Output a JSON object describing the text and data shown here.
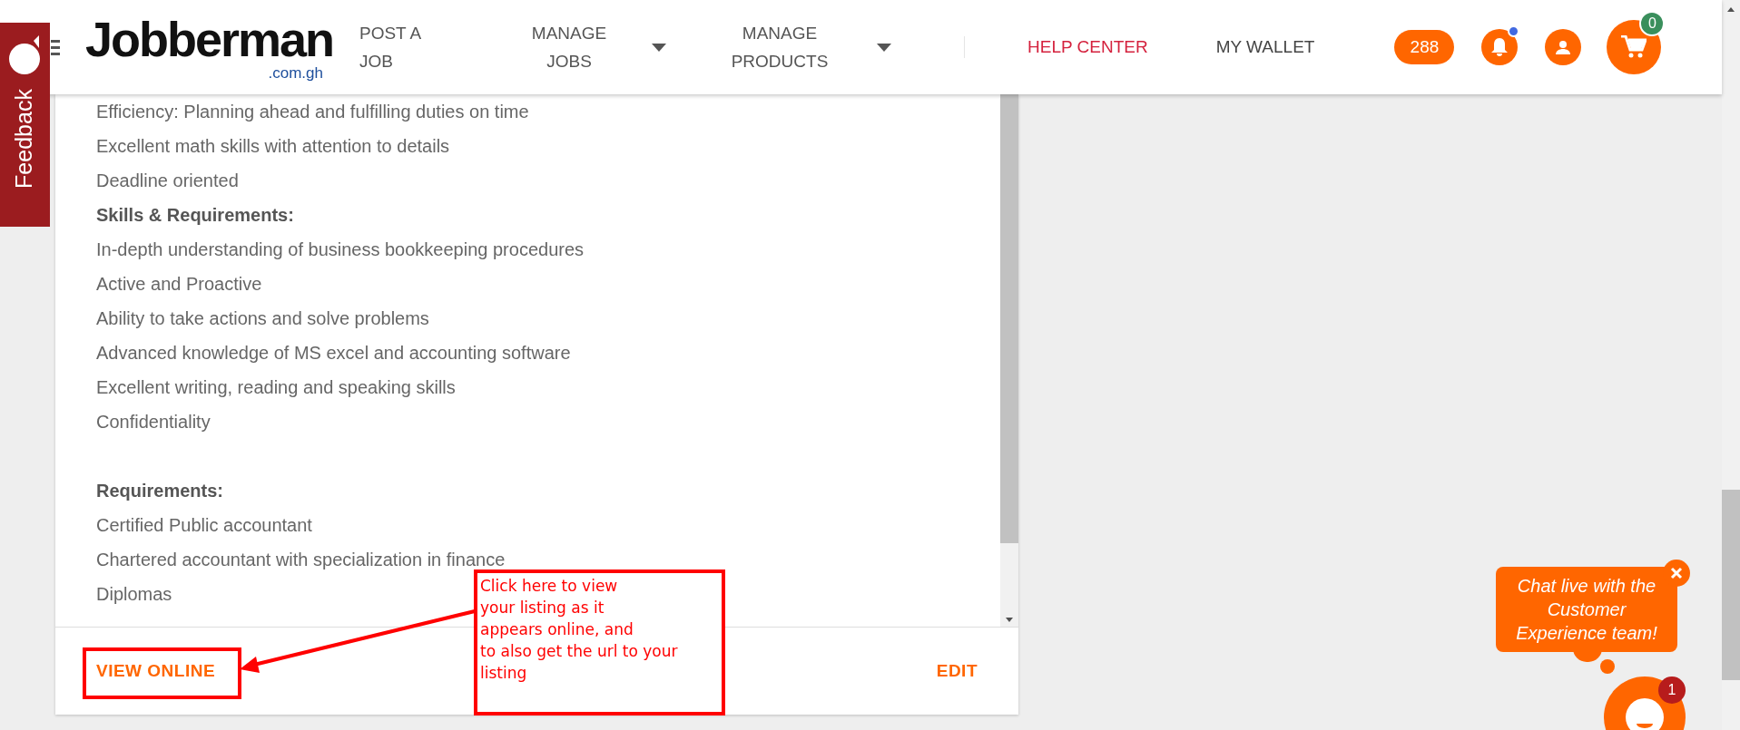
{
  "feedback_tab": {
    "label": "Feedback"
  },
  "header": {
    "logo": {
      "initial": "J",
      "rest": "obberman",
      "domain": ".com.gh"
    },
    "nav": [
      {
        "label": "POST A JOB",
        "dropdown": false
      },
      {
        "label": "MANAGE JOBS",
        "dropdown": true
      },
      {
        "label": "MANAGE PRODUCTS",
        "dropdown": true
      }
    ],
    "links": [
      {
        "label": "HELP CENTER",
        "kind": "highlight"
      },
      {
        "label": "MY WALLET",
        "kind": "plain"
      }
    ],
    "credits": "288",
    "notification_dot": true,
    "cart_count": "0"
  },
  "listing": {
    "lines": [
      {
        "kind": "item",
        "text": "Efficiency: Planning ahead and fulfilling duties on time"
      },
      {
        "kind": "item",
        "text": "Excellent math skills with attention to details"
      },
      {
        "kind": "item",
        "text": "Deadline oriented"
      },
      {
        "kind": "heading",
        "text": "Skills & Requirements:"
      },
      {
        "kind": "item",
        "text": "In-depth understanding of business bookkeeping procedures"
      },
      {
        "kind": "item",
        "text": "Active and Proactive"
      },
      {
        "kind": "item",
        "text": "Ability to take actions and solve problems"
      },
      {
        "kind": "item",
        "text": "Advanced knowledge of MS excel and accounting software"
      },
      {
        "kind": "item",
        "text": "Excellent writing, reading and speaking skills"
      },
      {
        "kind": "item",
        "text": "Confidentiality"
      },
      {
        "kind": "spacer"
      },
      {
        "kind": "heading",
        "text": "Requirements:"
      },
      {
        "kind": "item",
        "text": "Certified Public accountant"
      },
      {
        "kind": "item",
        "text": "Chartered accountant with specialization in finance"
      },
      {
        "kind": "item",
        "text": "Diplomas"
      }
    ],
    "actions": [
      {
        "label": "VIEW ONLINE"
      },
      {
        "label": "EDIT"
      }
    ]
  },
  "annotation": {
    "lines": [
      "Click here to view",
      "your listing as it",
      "appears online, and",
      "to also get the url to your",
      "listing"
    ]
  },
  "chat": {
    "message": "Chat live with the Customer Experience team!",
    "badge": "1"
  }
}
